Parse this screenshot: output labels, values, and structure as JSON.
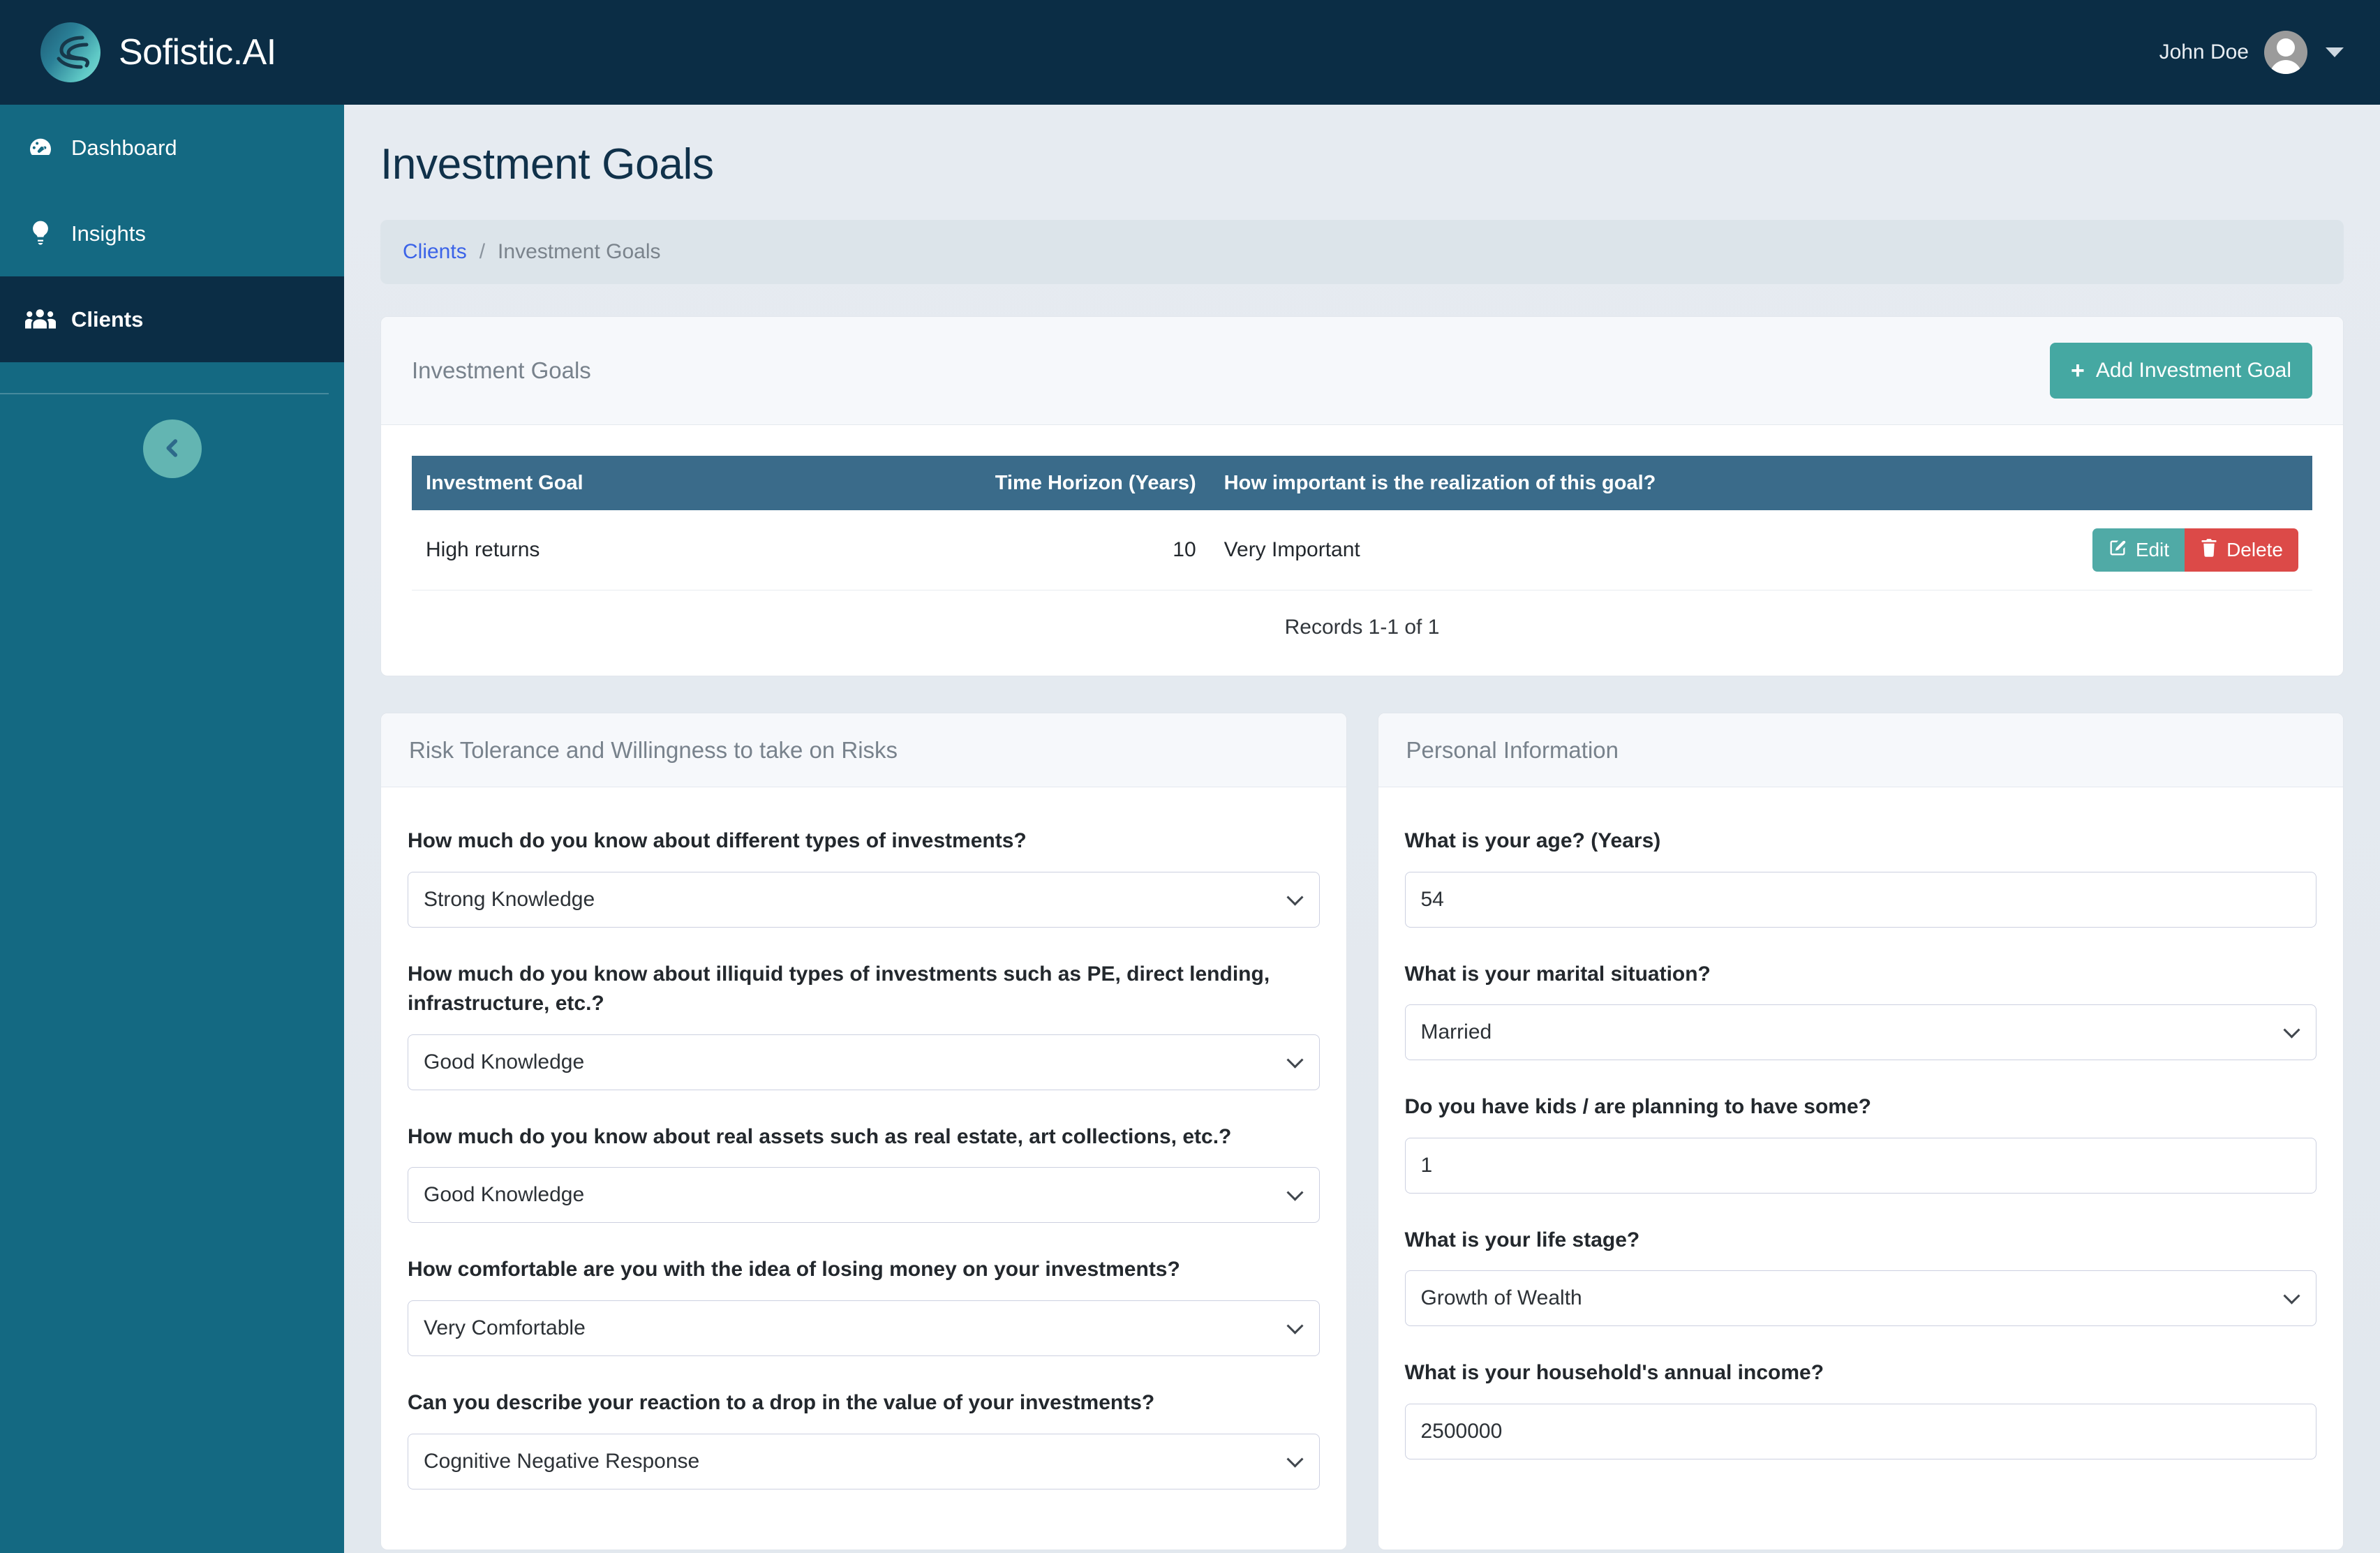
{
  "header": {
    "brand_name": "Sofistic.AI",
    "user_name": "John Doe"
  },
  "sidebar": {
    "items": [
      {
        "label": "Dashboard",
        "icon": "speedometer-icon",
        "active": false
      },
      {
        "label": "Insights",
        "icon": "lightbulb-icon",
        "active": false
      },
      {
        "label": "Clients",
        "icon": "users-icon",
        "active": true
      }
    ],
    "collapse_icon": "chevron-left-icon"
  },
  "page": {
    "title": "Investment Goals",
    "breadcrumb": {
      "link": "Clients",
      "separator": "/",
      "current": "Investment Goals"
    }
  },
  "goals_card": {
    "title": "Investment Goals",
    "add_button": "Add Investment Goal",
    "add_icon": "plus-icon",
    "columns": [
      "Investment Goal",
      "Time Horizon (Years)",
      "How important is the realization of this goal?",
      ""
    ],
    "rows": [
      {
        "goal": "High returns",
        "time_horizon": "10",
        "importance": "Very Important",
        "edit_label": "Edit",
        "delete_label": "Delete"
      }
    ],
    "records_text": "Records 1-1 of 1"
  },
  "risk_panel": {
    "title": "Risk Tolerance and Willingness to take on Risks",
    "fields": [
      {
        "label": "How much do you know about different types of investments?",
        "value": "Strong Knowledge",
        "type": "select"
      },
      {
        "label": "How much do you know about illiquid types of investments such as PE, direct lending, infrastructure, etc.?",
        "value": "Good Knowledge",
        "type": "select"
      },
      {
        "label": "How much do you know about real assets such as real estate, art collections, etc.?",
        "value": "Good Knowledge",
        "type": "select"
      },
      {
        "label": "How comfortable are you with the idea of losing money on your investments?",
        "value": "Very Comfortable",
        "type": "select"
      },
      {
        "label": "Can you describe your reaction to a drop in the value of your investments?",
        "value": "Cognitive Negative Response",
        "type": "select"
      }
    ]
  },
  "personal_panel": {
    "title": "Personal Information",
    "fields": [
      {
        "label": "What is your age? (Years)",
        "value": "54",
        "type": "text"
      },
      {
        "label": "What is your marital situation?",
        "value": "Married",
        "type": "select"
      },
      {
        "label": "Do you have kids / are planning to have some?",
        "value": "1",
        "type": "text"
      },
      {
        "label": "What is your life stage?",
        "value": "Growth of Wealth",
        "type": "select"
      },
      {
        "label": "What is your household's annual income?",
        "value": "2500000",
        "type": "text"
      }
    ]
  },
  "colors": {
    "header_navy": "#0b2d45",
    "sidebar_teal": "#146982",
    "accent_teal": "#45a8a2",
    "table_header_blue": "#3a6b8a",
    "danger_red": "#dc4a48",
    "link_blue": "#3b63e8"
  }
}
